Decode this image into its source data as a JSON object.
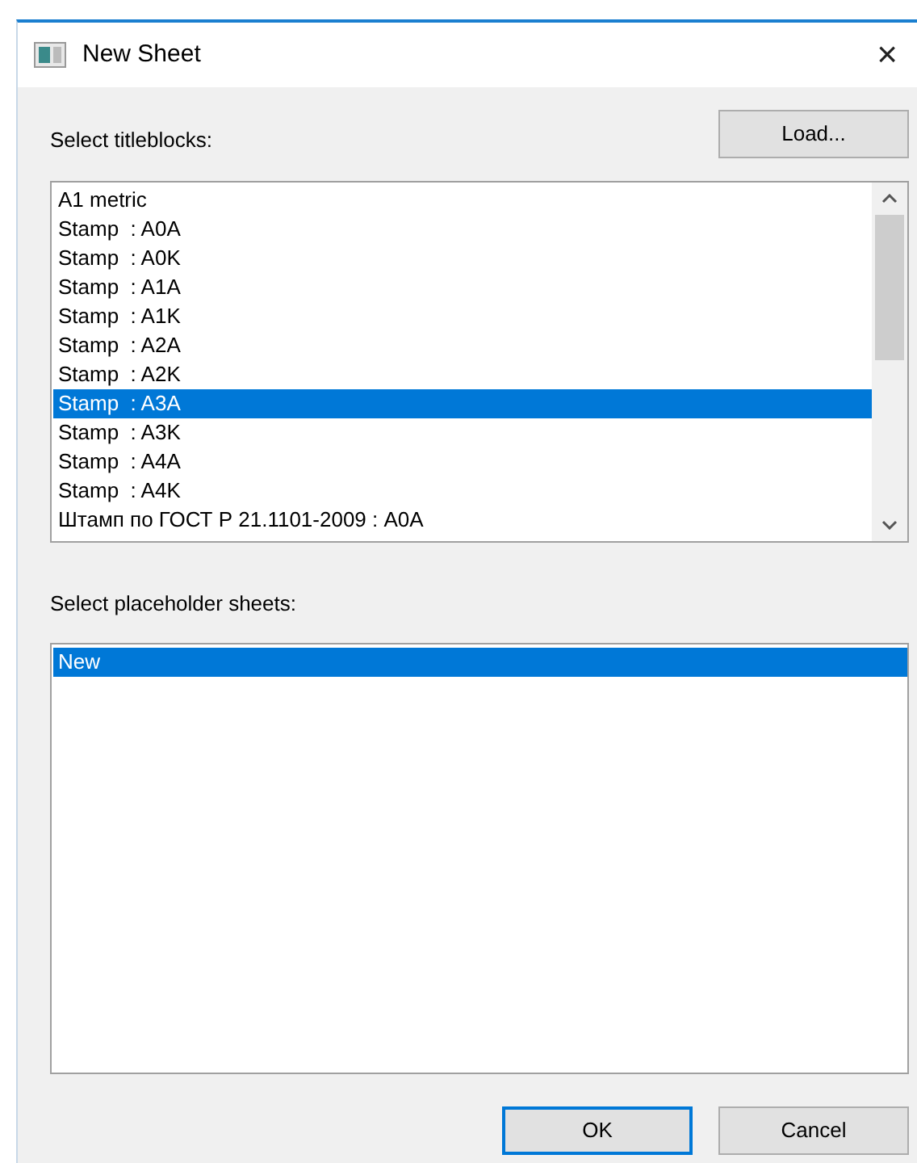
{
  "window": {
    "title": "New Sheet",
    "close": "×"
  },
  "titleblocks": {
    "label": "Select titleblocks:",
    "load_button": "Load...",
    "items": [
      {
        "text": "A1 metric",
        "selected": false
      },
      {
        "text": "Stamp  : A0A",
        "selected": false
      },
      {
        "text": "Stamp  : A0K",
        "selected": false
      },
      {
        "text": "Stamp  : A1A",
        "selected": false
      },
      {
        "text": "Stamp  : A1K",
        "selected": false
      },
      {
        "text": "Stamp  : A2A",
        "selected": false
      },
      {
        "text": "Stamp  : A2K",
        "selected": false
      },
      {
        "text": "Stamp  : A3A",
        "selected": true
      },
      {
        "text": "Stamp  : A3K",
        "selected": false
      },
      {
        "text": "Stamp  : A4A",
        "selected": false
      },
      {
        "text": "Stamp  : A4K",
        "selected": false
      },
      {
        "text": "Штамп по ГОСТ Р 21.1101-2009 : A0A",
        "selected": false
      }
    ]
  },
  "placeholders": {
    "label": "Select placeholder sheets:",
    "items": [
      {
        "text": "New",
        "selected": true
      }
    ]
  },
  "buttons": [
    {
      "label": "OK",
      "default": true
    },
    {
      "label": "Cancel",
      "default": false
    }
  ]
}
